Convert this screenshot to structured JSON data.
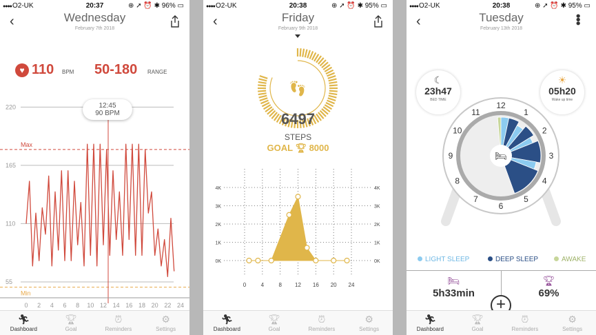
{
  "status_bar": [
    {
      "carrier": "O2-UK",
      "time": "20:37",
      "battery": "96%"
    },
    {
      "carrier": "O2-UK",
      "time": "20:38",
      "battery": "95%"
    },
    {
      "carrier": "O2-UK",
      "time": "20:38",
      "battery": "95%"
    }
  ],
  "tabs": [
    "Dashboard",
    "Goal",
    "Reminders",
    "Settings"
  ],
  "heart": {
    "day": "Wednesday",
    "date": "February 7th 2018",
    "bpm": "110",
    "bpm_unit": "BPM",
    "range": "50-180",
    "range_unit": "RANGE",
    "tooltip_time": "12:45",
    "tooltip_value": "90 BPM",
    "max_label": "Max",
    "min_label": "Min",
    "colors": {
      "line": "#d0493c",
      "max": "#d0493c",
      "min": "#e8a94a"
    }
  },
  "steps": {
    "day": "Friday",
    "date": "February 9th 2018",
    "count": "6497",
    "label": "STEPS",
    "goal_prefix": "GOAL",
    "goal_value": "8000",
    "color": "#e0b64a"
  },
  "sleep": {
    "day": "Tuesday",
    "date": "February 13th 2018",
    "bed_time": "23h47",
    "bed_label": "BED TIME",
    "wake_time": "05h20",
    "wake_label": "Wake up time",
    "legend": [
      {
        "label": "LIGHT SLEEP",
        "color": "#8ccbf0"
      },
      {
        "label": "DEEP SLEEP",
        "color": "#2b4f86"
      },
      {
        "label": "AWAKE",
        "color": "#c7d69a"
      }
    ],
    "duration": "5h33min",
    "quality": "69%",
    "clock_numbers": [
      "12",
      "1",
      "2",
      "3",
      "4",
      "5",
      "6",
      "7",
      "8",
      "9",
      "10",
      "11"
    ]
  },
  "chart_data": [
    {
      "type": "line",
      "x": [
        0,
        0.5,
        1,
        1.5,
        2,
        2.5,
        3,
        3.5,
        4,
        4.5,
        5,
        5.5,
        6,
        6.5,
        7,
        7.5,
        8,
        8.5,
        9,
        9.5,
        10,
        10.5,
        11,
        11.5,
        12,
        12.5,
        13,
        13.5,
        14,
        14.5,
        15,
        15.5,
        16,
        16.5,
        17,
        17.5,
        18,
        18.5,
        19,
        19.5,
        20,
        20.5,
        21,
        21.5,
        22,
        22.5,
        23
      ],
      "y": [
        110,
        150,
        70,
        120,
        75,
        125,
        100,
        155,
        70,
        140,
        85,
        160,
        75,
        160,
        75,
        150,
        90,
        130,
        70,
        185,
        80,
        185,
        70,
        185,
        90,
        180,
        80,
        160,
        95,
        140,
        80,
        185,
        95,
        185,
        80,
        185,
        80,
        180,
        120,
        140,
        80,
        105,
        70,
        95,
        60,
        115,
        65
      ],
      "xlabel": "",
      "ylabel": "",
      "xticks": [
        0,
        2,
        4,
        6,
        8,
        10,
        12,
        14,
        16,
        18,
        20,
        22,
        24
      ],
      "yticks": [
        55,
        110,
        165,
        220
      ],
      "xlim": [
        0,
        24
      ],
      "ylim": [
        40,
        230
      ],
      "max_line": 180,
      "min_line": 50,
      "marker_x": 12.75
    },
    {
      "type": "area",
      "x": [
        1,
        3,
        6,
        10,
        12,
        14,
        16,
        20,
        23
      ],
      "y": [
        0,
        0,
        0,
        2500,
        3500,
        700,
        0,
        0,
        0
      ],
      "xticks": [
        0,
        4,
        8,
        12,
        16,
        20,
        24
      ],
      "yticks": [
        0,
        1000,
        2000,
        3000,
        4000
      ],
      "ytick_labels": [
        "0K",
        "1K",
        "2K",
        "3K",
        "4K"
      ],
      "xlim": [
        0,
        24
      ],
      "ylim": [
        0,
        4000
      ]
    }
  ]
}
